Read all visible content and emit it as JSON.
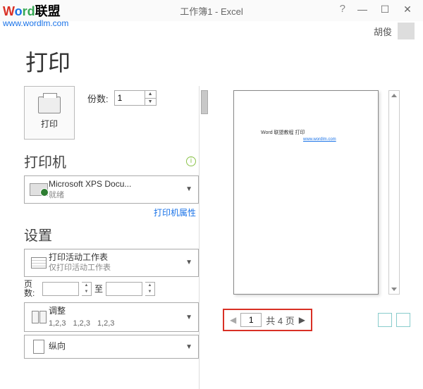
{
  "watermark": {
    "part1": "W",
    "part2": "o",
    "part3": "rd",
    "rest": "联盟",
    "url": "www.wordlm.com"
  },
  "title": "工作簿1 - Excel",
  "user": "胡俊",
  "main_heading": "打印",
  "print_button_label": "打印",
  "copies": {
    "label": "份数:",
    "value": "1"
  },
  "sections": {
    "printer": "打印机",
    "settings": "设置"
  },
  "printer": {
    "name": "Microsoft XPS Docu...",
    "status": "就绪",
    "properties_link": "打印机属性"
  },
  "settings": {
    "print_what": {
      "main": "打印活动工作表",
      "sub": "仅打印活动工作表"
    },
    "pages_label": "页数:",
    "pages_to": "至",
    "collate": {
      "main": "调整",
      "n1": "1,2,3",
      "n2": "1,2,3",
      "n3": "1,2,3"
    },
    "orientation": "纵向"
  },
  "preview": {
    "line1": "Word 联盟教程 打印",
    "line2": "www.wordlm.com"
  },
  "nav": {
    "current": "1",
    "total_label": "共 4 页"
  }
}
